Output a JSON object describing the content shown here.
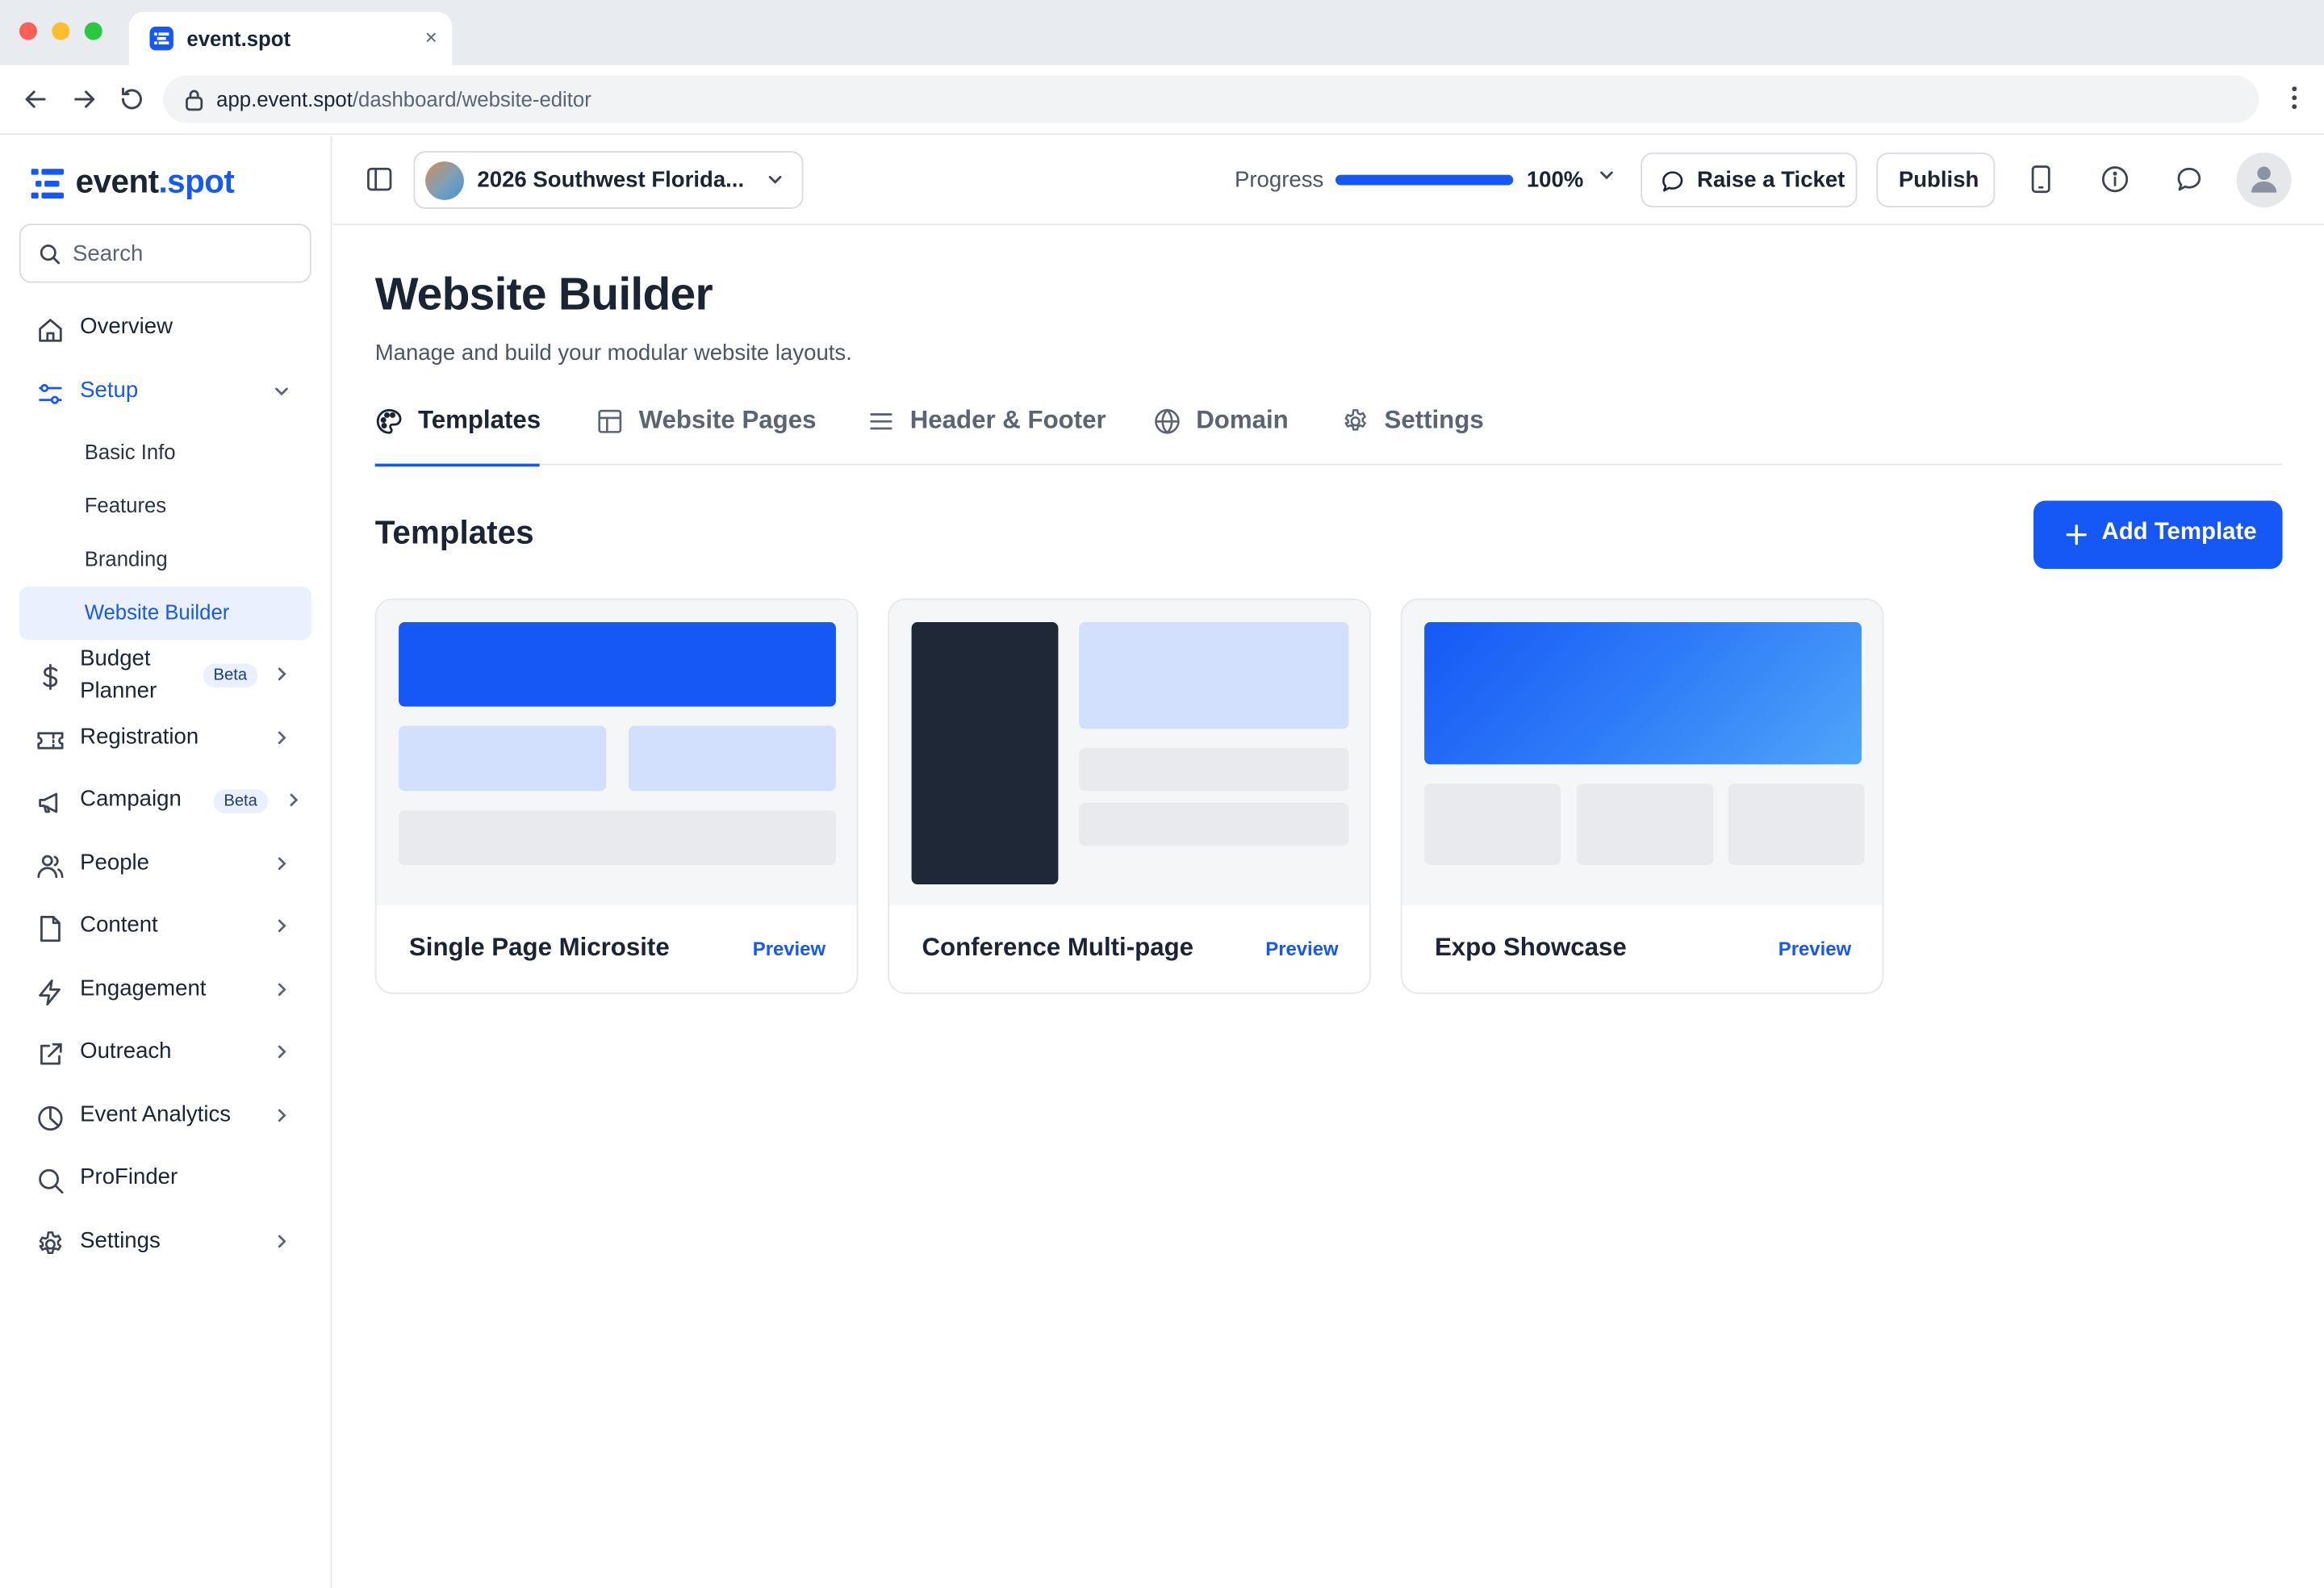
{
  "browser": {
    "tab_title": "event.spot",
    "tab_close": "×",
    "url_host": "app.event.spot",
    "url_path": "/dashboard/website-editor"
  },
  "sidebar": {
    "logo_event": "event",
    "logo_dot": ".",
    "logo_spot": "spot",
    "search_placeholder": "Search",
    "items": [
      {
        "label": "Overview",
        "icon": "home-icon"
      },
      {
        "label": "Setup",
        "icon": "sliders-icon",
        "expanded": true
      },
      {
        "label": "Budget",
        "label2": "Planner",
        "icon": "dollar-icon",
        "badge": "Beta"
      },
      {
        "label": "Registration",
        "icon": "ticket-icon"
      },
      {
        "label": "Campaign",
        "icon": "megaphone-icon",
        "badge": "Beta"
      },
      {
        "label": "People",
        "icon": "people-icon"
      },
      {
        "label": "Content",
        "icon": "file-icon"
      },
      {
        "label": "Engagement",
        "icon": "bolt-icon"
      },
      {
        "label": "Outreach",
        "icon": "external-link-icon"
      },
      {
        "label": "Event Analytics",
        "icon": "pie-chart-icon"
      },
      {
        "label": "ProFinder",
        "icon": "search-icon"
      },
      {
        "label": "Settings",
        "icon": "gear-icon"
      }
    ],
    "setup_sub": [
      {
        "label": "Basic Info"
      },
      {
        "label": "Features"
      },
      {
        "label": "Branding"
      },
      {
        "label": "Website Builder",
        "selected": true
      }
    ]
  },
  "topbar": {
    "event_name": "2026 Southwest Florida...",
    "progress_label": "Progress",
    "progress_value": 1.0,
    "progress_text": "100%",
    "raise_ticket": "Raise a Ticket",
    "publish": "Publish"
  },
  "main": {
    "title": "Website Builder",
    "subtitle": "Manage and build your modular website layouts.",
    "tabs": [
      {
        "label": "Templates",
        "icon": "palette-icon",
        "active": true
      },
      {
        "label": "Website Pages",
        "icon": "layout-icon"
      },
      {
        "label": "Header & Footer",
        "icon": "menu-lines-icon"
      },
      {
        "label": "Domain",
        "icon": "globe-icon"
      },
      {
        "label": "Settings",
        "icon": "gear-icon"
      }
    ],
    "section_title": "Templates",
    "add_button": "Add Template",
    "templates": [
      {
        "name": "Single Page Microsite",
        "action": "Preview"
      },
      {
        "name": "Conference Multi-page",
        "action": "Preview"
      },
      {
        "name": "Expo Showcase",
        "action": "Preview"
      }
    ]
  },
  "colors": {
    "accent": "#1558f5",
    "text": "#1b2435",
    "muted": "#5b6472",
    "selected_bg": "#eaf0fe"
  }
}
